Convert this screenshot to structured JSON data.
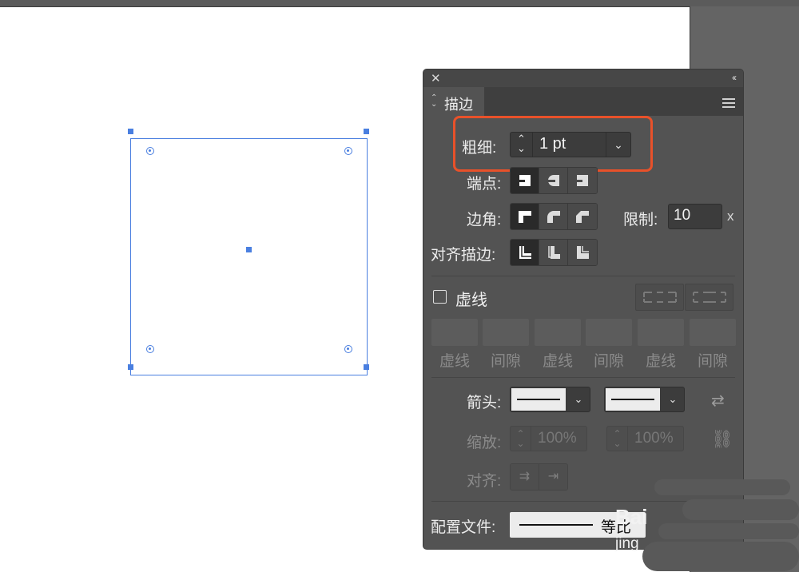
{
  "artboard": {
    "background": "#ffffff",
    "selection_color": "#4a7fe0"
  },
  "panel": {
    "close_glyph": "✕",
    "collapse_glyph": "‹‹",
    "tab_label": "描边",
    "menu_icon": "hamburger-menu-icon",
    "weight": {
      "label": "粗细:",
      "value": "1 pt"
    },
    "cap": {
      "label": "端点:",
      "icons": [
        "butt-cap-icon",
        "round-cap-icon",
        "projecting-cap-icon"
      ],
      "selected": 0
    },
    "corner": {
      "label": "边角:",
      "icons": [
        "miter-join-icon",
        "round-join-icon",
        "bevel-join-icon"
      ],
      "selected": 0
    },
    "limit": {
      "label": "限制:",
      "value": "10",
      "suffix": "x"
    },
    "align_stroke": {
      "label": "对齐描边:",
      "icons": [
        "align-center-icon",
        "align-inside-icon",
        "align-outside-icon"
      ],
      "selected": 0
    },
    "dashed": {
      "label": "虚线",
      "checked": false,
      "captions": [
        "虚线",
        "间隙",
        "虚线",
        "间隙",
        "虚线",
        "间隙"
      ]
    },
    "arrowheads": {
      "label": "箭头:"
    },
    "scale": {
      "label": "缩放:",
      "start": "100%",
      "end": "100%"
    },
    "align": {
      "label": "对齐:"
    },
    "profile": {
      "label": "配置文件:",
      "value": "等比"
    },
    "highlight_color": "#e8512a"
  },
  "watermark": {
    "text1": "Bai",
    "text2": "jing"
  }
}
